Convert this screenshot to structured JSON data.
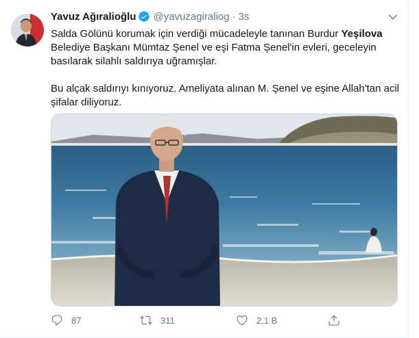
{
  "tweet": {
    "author": {
      "name": "Yavuz Ağıralioğlu",
      "handle": "@yavuzagiraliog",
      "separator": "·",
      "time": "3s"
    },
    "text": {
      "p1_part1": "Salda Gölünü korumak için verdiği mücadeleyle tanınan Burdur ",
      "p1_bold": "Yeşilova",
      "p1_part2": " Belediye Başkanı Mümtaz Şenel ve eşi Fatma Şenel'in evleri, geceleyin basılarak silahlı saldırıya uğramışlar.",
      "p2": "Bu alçak saldırıyı kınıyoruz. Ameliyata alınan M. Şenel ve eşine Allah'tan acil şifalar diliyoruz."
    },
    "actions": {
      "replies": "87",
      "retweets": "311",
      "likes": "2,1 B"
    }
  },
  "icons": [
    "verified-badge-icon",
    "chevron-down-icon",
    "reply-icon",
    "retweet-icon",
    "like-icon",
    "share-icon"
  ],
  "colors": {
    "verified": "#1da1f2",
    "secondary_text": "#657786",
    "border": "#e6ecf0"
  }
}
